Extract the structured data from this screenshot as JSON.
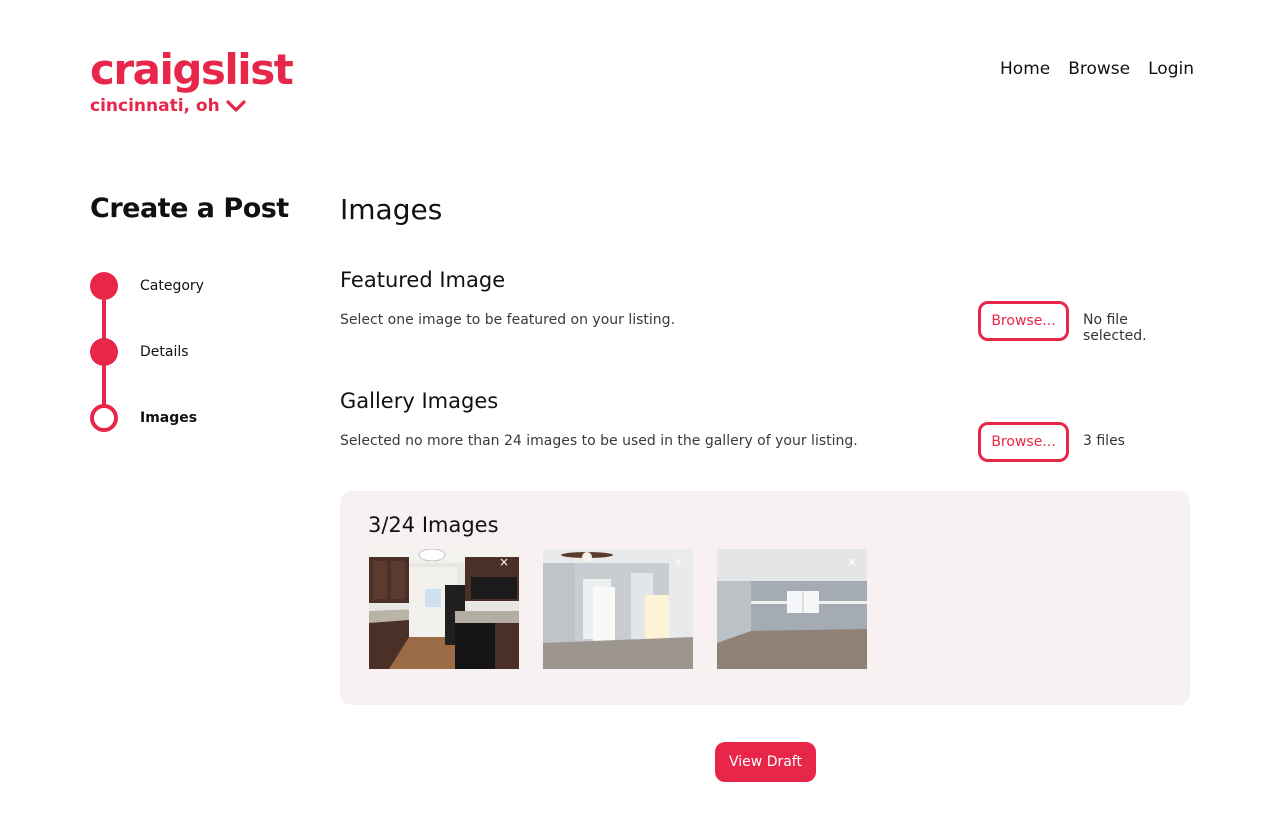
{
  "brand": {
    "logo": "craigslist",
    "location": "cincinnati, oh",
    "accent": "#e8264a"
  },
  "nav": {
    "items": [
      "Home",
      "Browse",
      "Login"
    ]
  },
  "sidebar": {
    "title": "Create a Post",
    "steps": [
      {
        "label": "Category",
        "state": "done"
      },
      {
        "label": "Details",
        "state": "done"
      },
      {
        "label": "Images",
        "state": "current"
      }
    ]
  },
  "main": {
    "title": "Images",
    "featured": {
      "title": "Featured Image",
      "description": "Select one image to be featured on your listing.",
      "browse_label": "Browse...",
      "status": "No file selected."
    },
    "gallery": {
      "title": "Gallery Images",
      "description": "Selected no more than 24 images to be used in the gallery of your listing.",
      "browse_label": "Browse...",
      "status": "3 files",
      "count_label": "3/24 Images",
      "remove_icon": "×"
    },
    "view_draft_label": "View Draft"
  }
}
